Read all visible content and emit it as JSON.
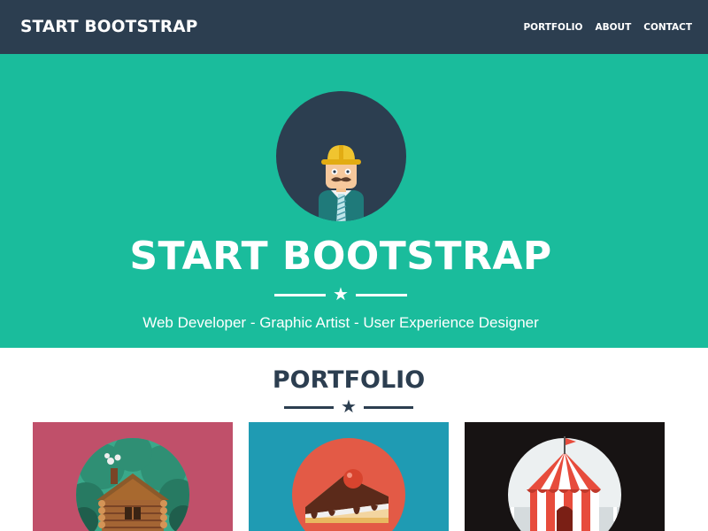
{
  "navbar": {
    "brand": "START BOOTSTRAP",
    "links": [
      "PORTFOLIO",
      "ABOUT",
      "CONTACT"
    ]
  },
  "masthead": {
    "avatar_icon": "developer-avatar-icon",
    "title": "START BOOTSTRAP",
    "divider_icon": "star-icon",
    "subheading": "Web Developer - Graphic Artist - User Experience Designer"
  },
  "portfolio": {
    "heading": "PORTFOLIO",
    "divider_icon": "star-icon",
    "items": [
      {
        "icon": "cabin-icon",
        "bg": "#c0506a"
      },
      {
        "icon": "cake-icon",
        "bg": "#1f9bb3"
      },
      {
        "icon": "circus-tent-icon",
        "bg": "#171313"
      }
    ]
  },
  "colors": {
    "navbar": "#2c3e50",
    "primary": "#1abc9c",
    "text_dark": "#2c3e50"
  }
}
